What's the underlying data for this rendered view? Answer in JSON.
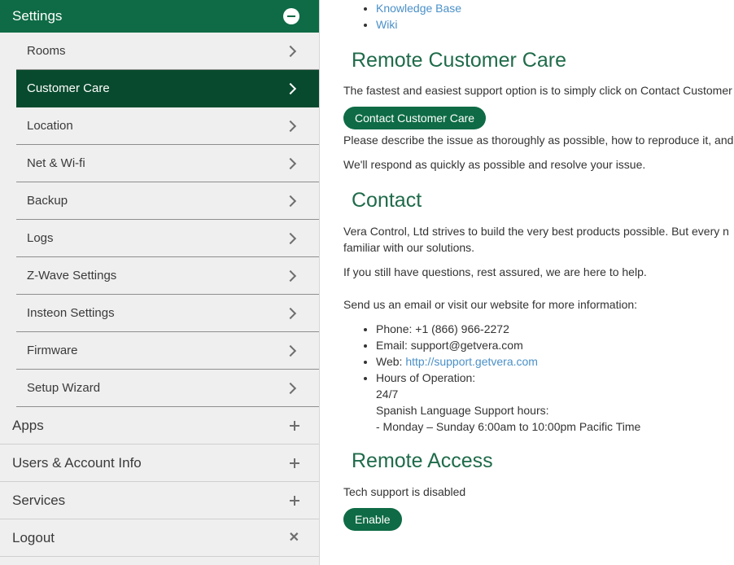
{
  "sidebar": {
    "header": "Settings",
    "sub_items": [
      {
        "label": "Rooms",
        "active": false
      },
      {
        "label": "Customer Care",
        "active": true
      },
      {
        "label": "Location",
        "active": false
      },
      {
        "label": "Net & Wi-fi",
        "active": false
      },
      {
        "label": "Backup",
        "active": false
      },
      {
        "label": "Logs",
        "active": false
      },
      {
        "label": "Z-Wave Settings",
        "active": false
      },
      {
        "label": "Insteon Settings",
        "active": false
      },
      {
        "label": "Firmware",
        "active": false
      },
      {
        "label": "Setup Wizard",
        "active": false
      }
    ],
    "top_items": [
      {
        "label": "Apps",
        "icon": "plus-icon"
      },
      {
        "label": "Users & Account Info",
        "icon": "plus-icon"
      },
      {
        "label": "Services",
        "icon": "plus-icon"
      },
      {
        "label": "Logout",
        "icon": "close-icon"
      }
    ]
  },
  "main": {
    "links": [
      "Knowledge Base",
      "Wiki"
    ],
    "remote_care": {
      "title": "Remote Customer Care",
      "intro": "The fastest and easiest support option is to simply click on Contact Customer",
      "button": "Contact Customer Care",
      "describe": "Please describe the issue as thoroughly as possible, how to reproduce it, and",
      "respond": "We'll respond as quickly as possible and resolve your issue."
    },
    "contact": {
      "title": "Contact",
      "p1_line1": "Vera Control, Ltd strives to build the very best products possible. But every n",
      "p1_line2": "familiar with our solutions.",
      "p2": "If you still have questions, rest assured, we are here to help.",
      "p3": "Send us an email or visit our website for more information:",
      "phone": "Phone: +1 (866) 966-2272",
      "email": "Email: support@getvera.com",
      "web_label": "Web: ",
      "web_link": "http://support.getvera.com",
      "hours_label": "Hours of Operation:",
      "hours_value": "24/7",
      "spanish_label": "Spanish Language Support hours:",
      "spanish_value": "- Monday – Sunday 6:00am to 10:00pm Pacific Time"
    },
    "remote_access": {
      "title": "Remote Access",
      "status": "Tech support is disabled",
      "button": "Enable"
    }
  },
  "colors": {
    "brand_green": "#0e6b45",
    "active_item": "#084a2e",
    "heading_green": "#1f6b4a",
    "link_blue": "#4a90c8"
  }
}
